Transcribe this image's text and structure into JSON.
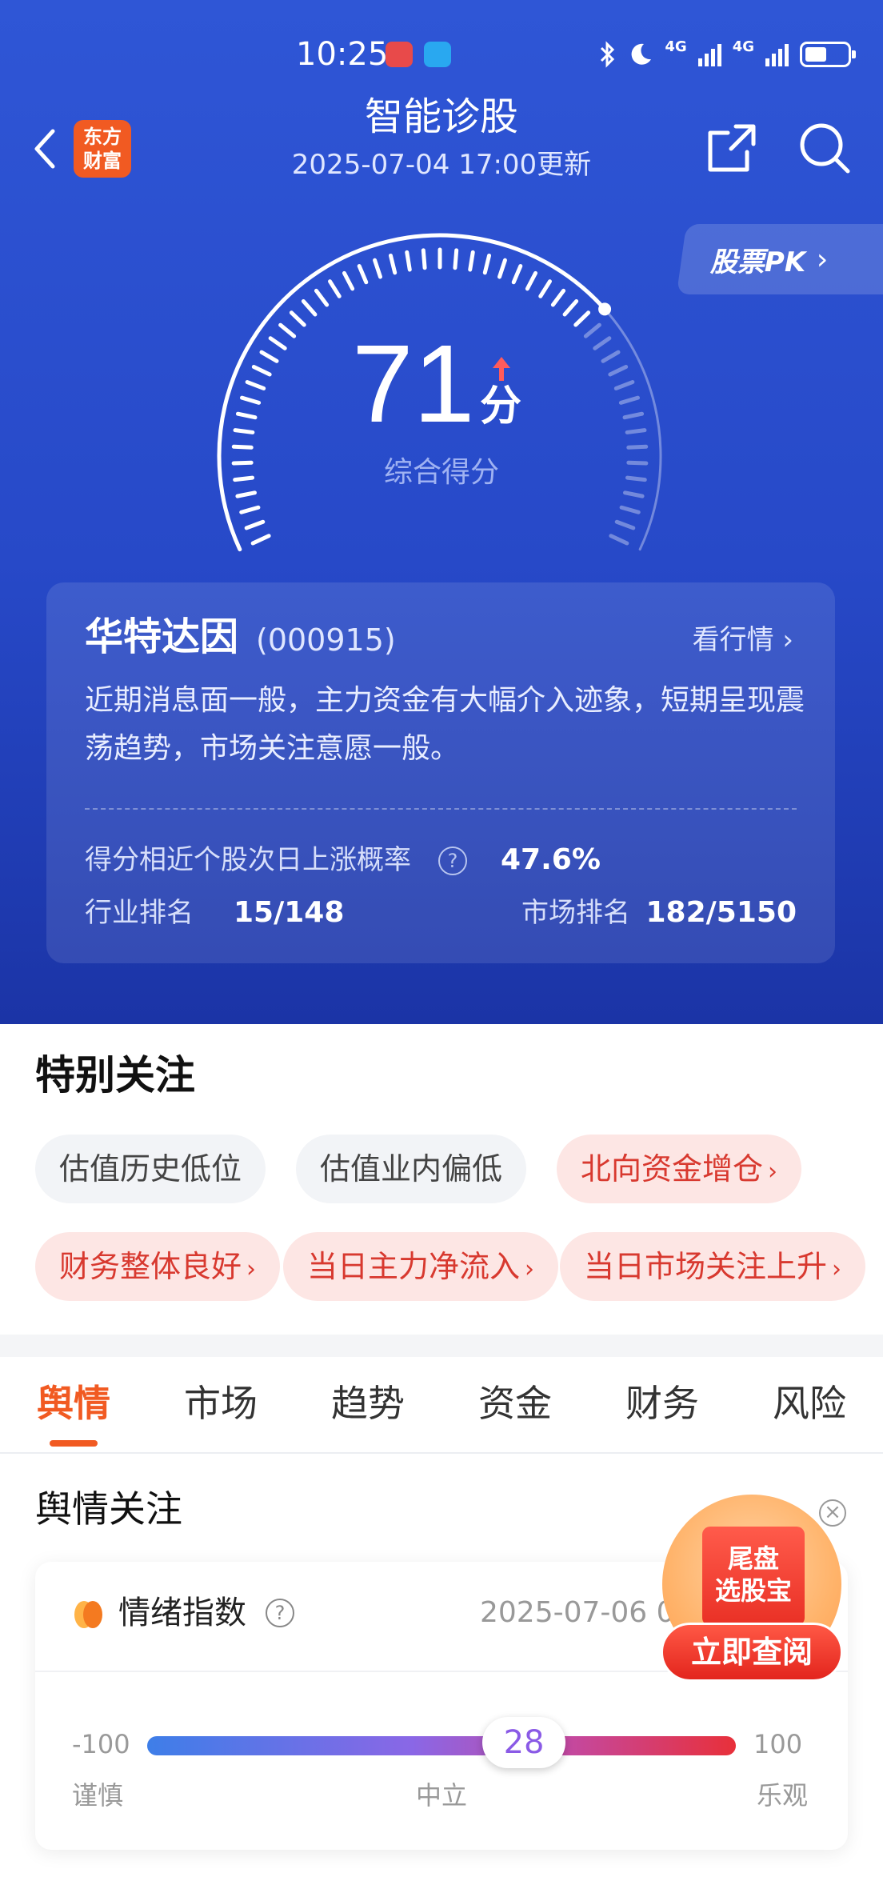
{
  "status_bar": {
    "time": "10:25",
    "network_1": "4G",
    "network_2": "4G",
    "icons": [
      "notification-red-icon",
      "notification-blue-icon",
      "bluetooth-icon",
      "moon-icon",
      "signal-icon",
      "battery-icon"
    ]
  },
  "header": {
    "title": "智能诊股",
    "subtitle": "2025-07-04 17:00更新",
    "brand_logo_line1": "东方",
    "brand_logo_line2": "财富",
    "pk_button": "股票PK"
  },
  "score": {
    "value": "71",
    "unit": "分",
    "label": "综合得分",
    "max": 100
  },
  "stock": {
    "name": "华特达因",
    "code": "(000915)",
    "view_quote": "看行情",
    "summary": "近期消息面一般，主力资金有大幅介入迹象，短期呈现震荡趋势，市场关注意愿一般。",
    "prob_label": "得分相近个股次日上涨概率",
    "prob_value": "47.6%",
    "industry_rank_label": "行业排名",
    "industry_rank_value": "15/148",
    "market_rank_label": "市场排名",
    "market_rank_value": "182/5150"
  },
  "special_attention": {
    "title": "特别关注",
    "tags": [
      {
        "label": "估值历史低位",
        "style": "neutral"
      },
      {
        "label": "估值业内偏低",
        "style": "neutral"
      },
      {
        "label": "北向资金增仓",
        "style": "hot"
      },
      {
        "label": "财务整体良好",
        "style": "hot"
      },
      {
        "label": "当日主力净流入",
        "style": "hot"
      },
      {
        "label": "当日市场关注上升",
        "style": "hot"
      }
    ]
  },
  "tabs": [
    "舆情",
    "市场",
    "趋势",
    "资金",
    "财务",
    "风险"
  ],
  "sentiment": {
    "section_title": "舆情关注",
    "card_title": "情绪指数",
    "date": "2025-07-06 0",
    "min": "-100",
    "max": "100",
    "value": "28",
    "value_fraction": 0.64,
    "label_cautious": "谨慎",
    "label_neutral": "中立",
    "label_optimistic": "乐观"
  },
  "promo": {
    "line1": "尾盘",
    "line2": "选股宝",
    "button": "立即查阅"
  },
  "colors": {
    "hero_blue": "#2f56d6",
    "accent_orange": "#f15a22",
    "hot_tag_text": "#d8392f",
    "hot_tag_bg": "#fde6e4"
  }
}
